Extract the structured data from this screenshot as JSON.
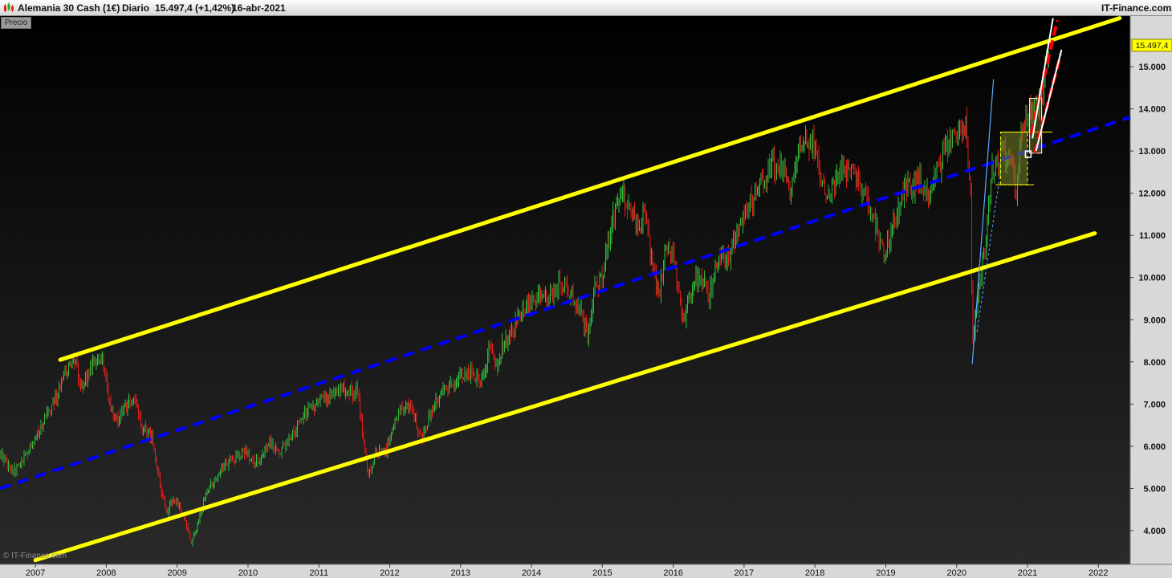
{
  "header": {
    "instrument": "Alemania 30 Cash (1€)",
    "timeframe": "Diario",
    "last_quote": "15.497,4 (+1,42%)",
    "date": "16-abr-2021",
    "brand": "IT-Finance.com"
  },
  "panel_label": "Precio",
  "watermark": "© IT-Finance.com",
  "last_price_label": "15.497,4",
  "colors": {
    "background_top": "#000000",
    "background_bottom": "#2a2a2a",
    "channel_lines": "#ffff00",
    "median_line": "#0000ff",
    "candle_up": "#2fbf3a",
    "candle_down": "#e0201c",
    "price_tag": "#ffff00",
    "recent_channel_outer": "#ff0000",
    "recent_channel_inner": "#ffffff",
    "steep_trend": "#5aa9ff"
  },
  "chart_data": {
    "type": "candlestick",
    "title": "Alemania 30 Cash (1€)",
    "timeframe": "Diario",
    "x_range": [
      2006.5,
      2022.45
    ],
    "y_range": [
      3200,
      16200
    ],
    "y_ticks": [
      4000,
      5000,
      6000,
      7000,
      8000,
      9000,
      10000,
      11000,
      12000,
      13000,
      14000,
      15000
    ],
    "y_tick_labels": [
      "4.000",
      "5.000",
      "6.000",
      "7.000",
      "8.000",
      "9.000",
      "10.000",
      "11.000",
      "12.000",
      "13.000",
      "14.000",
      "15.000"
    ],
    "x_ticks": [
      2007,
      2008,
      2009,
      2010,
      2011,
      2012,
      2013,
      2014,
      2015,
      2016,
      2017,
      2018,
      2019,
      2020,
      2021,
      2022
    ],
    "x_tick_labels": [
      "2007",
      "2008",
      "2009",
      "2010",
      "2011",
      "2012",
      "2013",
      "2014",
      "2015",
      "2016",
      "2017",
      "2018",
      "2019",
      "2020",
      "2021",
      "2022"
    ],
    "last_price": 15497.4,
    "price_path": [
      [
        2006.5,
        5800
      ],
      [
        2006.7,
        5400
      ],
      [
        2006.9,
        5900
      ],
      [
        2007.1,
        6500
      ],
      [
        2007.3,
        7200
      ],
      [
        2007.45,
        7900
      ],
      [
        2007.55,
        8000
      ],
      [
        2007.65,
        7400
      ],
      [
        2007.8,
        7900
      ],
      [
        2007.95,
        8000
      ],
      [
        2008.05,
        7000
      ],
      [
        2008.15,
        6600
      ],
      [
        2008.25,
        6900
      ],
      [
        2008.4,
        7100
      ],
      [
        2008.5,
        6500
      ],
      [
        2008.65,
        6200
      ],
      [
        2008.75,
        5200
      ],
      [
        2008.85,
        4400
      ],
      [
        2008.95,
        4800
      ],
      [
        2009.05,
        4500
      ],
      [
        2009.15,
        4000
      ],
      [
        2009.2,
        3700
      ],
      [
        2009.3,
        4200
      ],
      [
        2009.4,
        4800
      ],
      [
        2009.5,
        5200
      ],
      [
        2009.65,
        5500
      ],
      [
        2009.8,
        5700
      ],
      [
        2009.95,
        5900
      ],
      [
        2010.1,
        5600
      ],
      [
        2010.3,
        6100
      ],
      [
        2010.45,
        5800
      ],
      [
        2010.6,
        6200
      ],
      [
        2010.8,
        6800
      ],
      [
        2010.95,
        7000
      ],
      [
        2011.1,
        7200
      ],
      [
        2011.25,
        7400
      ],
      [
        2011.4,
        7300
      ],
      [
        2011.55,
        7300
      ],
      [
        2011.62,
        6200
      ],
      [
        2011.7,
        5300
      ],
      [
        2011.8,
        5900
      ],
      [
        2011.95,
        5900
      ],
      [
        2012.1,
        6700
      ],
      [
        2012.25,
        7000
      ],
      [
        2012.35,
        6700
      ],
      [
        2012.45,
        6100
      ],
      [
        2012.55,
        6700
      ],
      [
        2012.7,
        7200
      ],
      [
        2012.85,
        7400
      ],
      [
        2013.0,
        7700
      ],
      [
        2013.15,
        7800
      ],
      [
        2013.3,
        7500
      ],
      [
        2013.4,
        8300
      ],
      [
        2013.5,
        7900
      ],
      [
        2013.6,
        8400
      ],
      [
        2013.75,
        8800
      ],
      [
        2013.95,
        9400
      ],
      [
        2014.1,
        9600
      ],
      [
        2014.25,
        9500
      ],
      [
        2014.4,
        9900
      ],
      [
        2014.55,
        9600
      ],
      [
        2014.7,
        9100
      ],
      [
        2014.8,
        8600
      ],
      [
        2014.9,
        9800
      ],
      [
        2015.0,
        10000
      ],
      [
        2015.15,
        11400
      ],
      [
        2015.28,
        12000
      ],
      [
        2015.4,
        11500
      ],
      [
        2015.5,
        11200
      ],
      [
        2015.6,
        11500
      ],
      [
        2015.7,
        10300
      ],
      [
        2015.8,
        9600
      ],
      [
        2015.9,
        10800
      ],
      [
        2016.0,
        10500
      ],
      [
        2016.1,
        9300
      ],
      [
        2016.15,
        8900
      ],
      [
        2016.3,
        10100
      ],
      [
        2016.45,
        9800
      ],
      [
        2016.5,
        9500
      ],
      [
        2016.65,
        10500
      ],
      [
        2016.8,
        10600
      ],
      [
        2016.95,
        11400
      ],
      [
        2017.1,
        11800
      ],
      [
        2017.25,
        12200
      ],
      [
        2017.4,
        12700
      ],
      [
        2017.55,
        12500
      ],
      [
        2017.65,
        12100
      ],
      [
        2017.8,
        13000
      ],
      [
        2017.9,
        13200
      ],
      [
        2018.0,
        13200
      ],
      [
        2018.1,
        12200
      ],
      [
        2018.2,
        12100
      ],
      [
        2018.35,
        12500
      ],
      [
        2018.5,
        12700
      ],
      [
        2018.6,
        12400
      ],
      [
        2018.75,
        11800
      ],
      [
        2018.9,
        11000
      ],
      [
        2018.98,
        10600
      ],
      [
        2019.1,
        11200
      ],
      [
        2019.25,
        12000
      ],
      [
        2019.4,
        12200
      ],
      [
        2019.5,
        12400
      ],
      [
        2019.6,
        11800
      ],
      [
        2019.75,
        12700
      ],
      [
        2019.9,
        13200
      ],
      [
        2020.05,
        13500
      ],
      [
        2020.12,
        13700
      ],
      [
        2020.2,
        12000
      ],
      [
        2020.22,
        8500
      ],
      [
        2020.3,
        9500
      ],
      [
        2020.4,
        10800
      ],
      [
        2020.5,
        12500
      ],
      [
        2020.6,
        12800
      ],
      [
        2020.7,
        13000
      ],
      [
        2020.8,
        12500
      ],
      [
        2020.83,
        11600
      ],
      [
        2020.9,
        13300
      ],
      [
        2021.0,
        13800
      ],
      [
        2021.1,
        14000
      ],
      [
        2021.2,
        14500
      ],
      [
        2021.3,
        15497
      ]
    ],
    "channel": {
      "upper": [
        [
          2007.35,
          8050
        ],
        [
          2022.3,
          16150
        ]
      ],
      "lower": [
        [
          2007.0,
          3300
        ],
        [
          2021.95,
          11050
        ]
      ],
      "median": [
        [
          2006.5,
          5000
        ],
        [
          2022.45,
          13800
        ]
      ]
    },
    "annotations": {
      "steep_trend": [
        [
          2020.22,
          7950
        ],
        [
          2020.52,
          14700
        ]
      ],
      "consolidation_box": [
        [
          2020.62,
          12200
        ],
        [
          2021.0,
          13450
        ]
      ],
      "breakout_box": [
        [
          2021.03,
          12950
        ],
        [
          2021.2,
          14250
        ]
      ]
    }
  }
}
